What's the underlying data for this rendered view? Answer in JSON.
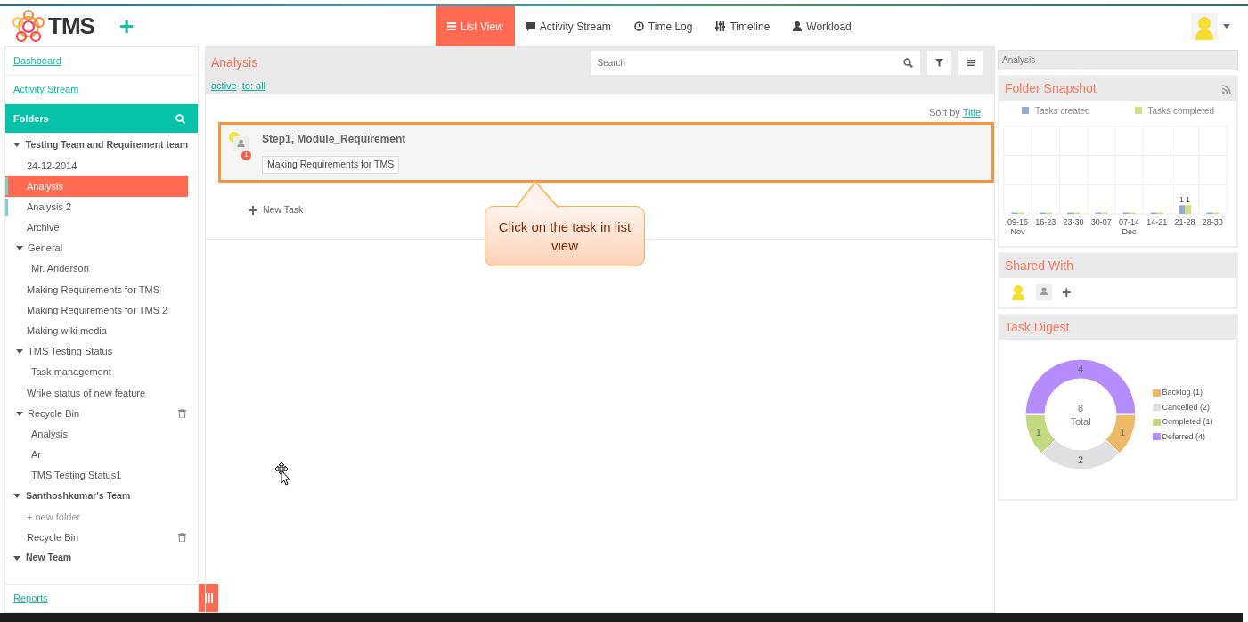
{
  "header": {
    "logo": "TMS",
    "add_button": "+",
    "tabs": [
      {
        "label": "List View",
        "selected": true
      },
      {
        "label": "Activity Stream",
        "selected": false
      },
      {
        "label": "Time Log",
        "selected": false
      },
      {
        "label": "Timeline",
        "selected": false
      },
      {
        "label": "Workload",
        "selected": false
      }
    ]
  },
  "sidebar": {
    "links": [
      {
        "label": "Dashboard"
      },
      {
        "label": "Activity Stream"
      }
    ],
    "folders_title": "Folders",
    "tree": [
      {
        "label": "Testing Team and Requirement team",
        "kind": "team",
        "expanded": true,
        "selected": false,
        "marked": false,
        "children": [
          {
            "label": "24-12-2014",
            "kind": "folder",
            "selected": false,
            "marked": false
          },
          {
            "label": "Analysis",
            "kind": "folder",
            "selected": true,
            "marked": true
          },
          {
            "label": "Analysis 2",
            "kind": "folder",
            "selected": false,
            "marked": true
          },
          {
            "label": "Archive",
            "kind": "folder",
            "selected": false,
            "marked": false
          },
          {
            "label": "General",
            "kind": "folder",
            "expanded": true,
            "selected": false,
            "marked": false,
            "children": [
              {
                "label": "Mr. Anderson",
                "kind": "folder",
                "selected": false,
                "marked": false
              }
            ]
          },
          {
            "label": "Making Requirements for TMS",
            "kind": "folder",
            "selected": false,
            "marked": false
          },
          {
            "label": "Making Requirements for TMS 2",
            "kind": "folder",
            "selected": false,
            "marked": false
          },
          {
            "label": "Making wiki media",
            "kind": "folder",
            "selected": false,
            "marked": false
          },
          {
            "label": "TMS Testing Status",
            "kind": "folder",
            "expanded": true,
            "selected": false,
            "marked": false,
            "children": [
              {
                "label": "Task management",
                "kind": "folder",
                "selected": false,
                "marked": false
              }
            ]
          },
          {
            "label": "Wrike status of new feature",
            "kind": "folder",
            "selected": false,
            "marked": false
          },
          {
            "label": "Recycle Bin",
            "kind": "bin",
            "expanded": true,
            "selected": false,
            "marked": false,
            "children": [
              {
                "label": "Analysis",
                "kind": "folder",
                "selected": false,
                "marked": false
              },
              {
                "label": "Ar",
                "kind": "folder",
                "selected": false,
                "marked": false
              },
              {
                "label": "TMS Testing Status1",
                "kind": "folder",
                "selected": false,
                "marked": false
              }
            ]
          }
        ]
      },
      {
        "label": "Santhoshkumar's Team",
        "kind": "team",
        "expanded": true,
        "selected": false,
        "marked": false,
        "children": [
          {
            "label": "+ new folder",
            "kind": "add",
            "selected": false,
            "marked": false
          },
          {
            "label": "Recycle Bin",
            "kind": "bin",
            "selected": false,
            "marked": false
          }
        ]
      },
      {
        "label": "New Team",
        "kind": "team",
        "expanded": true,
        "selected": false,
        "marked": false
      }
    ],
    "footer": "Reports"
  },
  "main": {
    "title": "Analysis",
    "filters": [
      "active",
      "to: all"
    ],
    "search": {
      "placeholder": "Search"
    },
    "sort": {
      "label": "Sort by",
      "value": "Title"
    },
    "tasks": [
      {
        "title": "Step1, Module_Requirement",
        "badge": "1",
        "tag": "Making Requirements for TMS",
        "highlighted": true
      }
    ],
    "new_task": "New Task",
    "callout": "Click on the task in list view"
  },
  "right": {
    "breadcrumb": "Analysis",
    "snapshot": {
      "title": "Folder Snapshot",
      "chart_data": {
        "type": "bar",
        "categories": [
          "09-16\nNov",
          "16-23",
          "23-30",
          "30-07",
          "07-14\nDec",
          "14-21",
          "21-28",
          "28-30"
        ],
        "series": [
          {
            "name": "Tasks created",
            "color": "#93a9d6",
            "values": [
              0,
              0,
              0,
              0,
              0,
              0,
              1,
              0
            ],
            "value_labels": [
              null,
              null,
              null,
              null,
              null,
              null,
              "1",
              null
            ]
          },
          {
            "name": "Tasks completed",
            "color": "#cde27c",
            "values": [
              0,
              0,
              0,
              0,
              0,
              0,
              1,
              0
            ],
            "value_labels": [
              null,
              null,
              null,
              null,
              null,
              null,
              "1",
              null
            ]
          }
        ],
        "ylim": [
          0,
          10
        ]
      }
    },
    "shared": {
      "title": "Shared With",
      "add": "+"
    },
    "digest": {
      "title": "Task Digest",
      "chart_data": {
        "type": "donut",
        "values": [
          1,
          2,
          1,
          4
        ],
        "data_labels": true
      },
      "legend": [
        {
          "label": "Backlog (1)",
          "color": "#ecb966"
        },
        {
          "label": "Cancelled (2)",
          "color": "#e0e0e0"
        },
        {
          "label": "Completed (1)",
          "color": "#c4d880"
        },
        {
          "label": "Deferred (4)",
          "color": "#b58cfb"
        }
      ],
      "center_value": "8",
      "center_label": "Total"
    }
  }
}
